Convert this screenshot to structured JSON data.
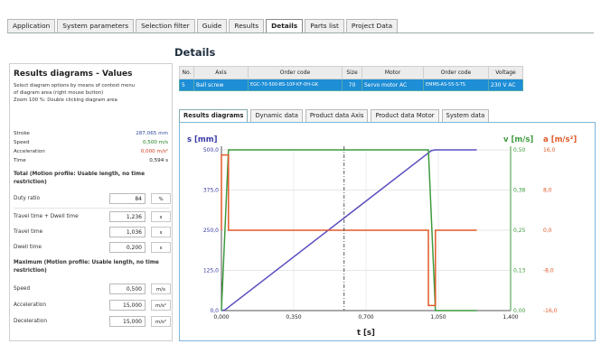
{
  "tabs": [
    "Application",
    "System parameters",
    "Selection filter",
    "Guide",
    "Results",
    "Details",
    "Parts list",
    "Project Data"
  ],
  "active_tab": "Details",
  "details_title": "Details",
  "left": {
    "title": "Results diagrams - Values",
    "note1": "Select diagram options by means of context menu",
    "note2": "of diagram area (right mouse button)",
    "note3": "Zoom 100 %: Double clicking diagram area",
    "stroke_label": "Stroke",
    "stroke_value": "287,065 mm",
    "speed_label": "Speed",
    "speed_value": "0,500 m/s",
    "accel_label": "Acceleration",
    "accel_value": "0,000 m/s²",
    "time_label": "Time",
    "time_value": "0,594 s",
    "total_heading": "Total (Motion profile: Usable length, no time restriction)",
    "duty_label": "Duty ratio",
    "duty_value": "84",
    "duty_unit": "%",
    "tdw_label": "Travel time + Dwell time",
    "tdw_value": "1,236",
    "tdw_unit": "s",
    "tt_label": "Travel time",
    "tt_value": "1,036",
    "tt_unit": "s",
    "dwell_label": "Dwell time",
    "dwell_value": "0,200",
    "dwell_unit": "s",
    "max_heading": "Maximum (Motion profile: Usable length, no time restriction)",
    "mspeed_label": "Speed",
    "mspeed_value": "0,500",
    "mspeed_unit": "m/s",
    "macc_label": "Acceleration",
    "macc_value": "15,000",
    "macc_unit": "m/s²",
    "mdec_label": "Deceleration",
    "mdec_value": "15,000",
    "mdec_unit": "m/s²"
  },
  "table": {
    "headers": [
      "No.",
      "Axis",
      "Order code",
      "Size",
      "Motor",
      "Order code",
      "Voltage"
    ],
    "row": [
      "5",
      "Ball screw",
      "EGC-70-500-BS-10P-KF-0H-GK",
      "70",
      "Servo motor AC",
      "EMMS-AS-55-S-TS",
      "230 V AC"
    ]
  },
  "chart_tabs": [
    "Results diagrams",
    "Dynamic data",
    "Product data Axis",
    "Product data Motor",
    "System data"
  ],
  "active_chart_tab": "Results diagrams",
  "colors": {
    "position": "#5a4fc0",
    "velocity": "#3d9a3d",
    "acceleration": "#e05a2a",
    "cursor": "#333333",
    "table_row": "#1e8ed6"
  },
  "chart_data": {
    "type": "line",
    "x_label": "t [s]",
    "s_axis_label": "s [mm]",
    "v_axis_label": "v [m/s]",
    "a_axis_label": "a [m/s²]",
    "x_ticks": [
      "0,000",
      "0,350",
      "0,700",
      "1,050",
      "1,400"
    ],
    "x_tick_values": [
      0,
      0.35,
      0.7,
      1.05,
      1.4
    ],
    "s_ticks": [
      "500,0",
      "375,0",
      "250,0",
      "125,0",
      "0,0"
    ],
    "s_tick_values": [
      500,
      375,
      250,
      125,
      0
    ],
    "v_ticks": [
      "0,50",
      "0,38",
      "0,25",
      "0,13",
      "0,00"
    ],
    "v_tick_values": [
      0.5,
      0.375,
      0.25,
      0.125,
      0
    ],
    "a_ticks": [
      "16,0",
      "8,0",
      "0,0",
      "-8,0",
      "-16,0"
    ],
    "a_tick_values": [
      16,
      8,
      0,
      -8,
      -16
    ],
    "xlim": [
      0,
      1.4
    ],
    "s_lim": [
      0,
      500
    ],
    "v_lim": [
      0,
      0.5
    ],
    "a_lim": [
      -16,
      16
    ],
    "cursor_x": 0.594,
    "series": [
      {
        "key": "position",
        "x": [
          0,
          0.017,
          1.017,
          1.036,
          1.236
        ],
        "y": [
          0,
          2,
          498,
          500,
          500
        ],
        "axis": "s"
      },
      {
        "key": "velocity",
        "x": [
          0,
          0.017,
          0.034,
          1.002,
          1.019,
          1.036,
          1.236
        ],
        "y": [
          0,
          0.25,
          0.5,
          0.5,
          0.25,
          0,
          0
        ],
        "axis": "v"
      },
      {
        "key": "acceleration",
        "x": [
          0,
          0,
          0.034,
          0.034,
          1.002,
          1.002,
          1.036,
          1.036,
          1.236
        ],
        "y": [
          0,
          15,
          15,
          0,
          0,
          -15,
          -15,
          0,
          0
        ],
        "axis": "a"
      }
    ]
  }
}
